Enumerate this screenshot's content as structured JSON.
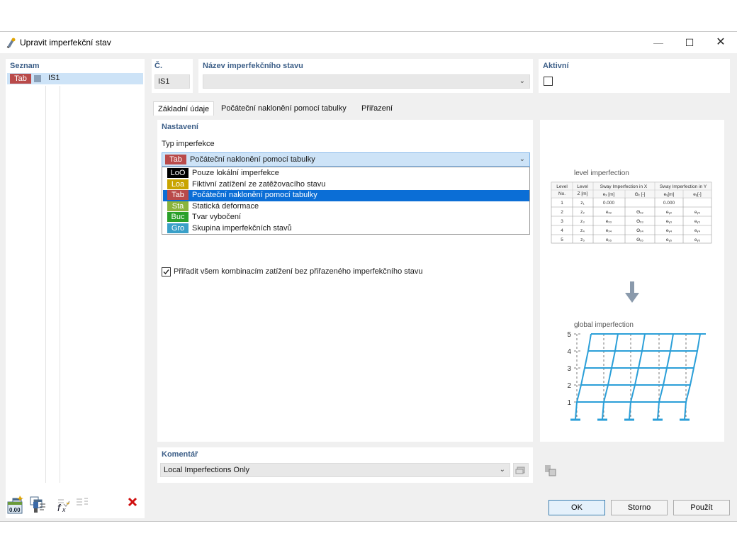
{
  "window": {
    "title": "Upravit imperfekční stav"
  },
  "sidebar": {
    "title": "Seznam",
    "items": [
      {
        "tag": "Tab",
        "tag_color": "#b94a4a",
        "label": "IS1"
      }
    ]
  },
  "header": {
    "number_label": "Č.",
    "number_value": "IS1",
    "name_label": "Název imperfekčního stavu",
    "name_value": "",
    "active_label": "Aktivní"
  },
  "tabs": [
    {
      "label": "Základní údaje",
      "active": true
    },
    {
      "label": "Počáteční naklonění pomocí tabulky",
      "active": false
    },
    {
      "label": "Přiřazení",
      "active": false
    }
  ],
  "settings": {
    "title": "Nastavení",
    "type_label": "Typ imperfekce",
    "selected": {
      "tag": "Tab",
      "color": "#b94a4a",
      "label": "Počáteční naklonění pomocí tabulky"
    },
    "options": [
      {
        "tag": "LoO",
        "color": "#000000",
        "label": "Pouze lokální imperfekce",
        "selected": false
      },
      {
        "tag": "Loa",
        "color": "#c9a400",
        "label": "Fiktivní zatížení ze zatěžovacího stavu",
        "selected": false
      },
      {
        "tag": "Tab",
        "color": "#b94a4a",
        "label": "Počáteční naklonění pomocí tabulky",
        "selected": true
      },
      {
        "tag": "Sta",
        "color": "#8ab43c",
        "label": "Statická deformace",
        "selected": false
      },
      {
        "tag": "Buc",
        "color": "#2aa02a",
        "label": "Tvar vybočení",
        "selected": false
      },
      {
        "tag": "Gro",
        "color": "#3aa0c8",
        "label": "Skupina imperfekčních stavů",
        "selected": false
      }
    ],
    "assign_checkbox_label": "Přiřadit všem kombinacím zatížení bez přiřazeného imperfekčního stavu",
    "assign_checked": true
  },
  "comment": {
    "title": "Komentář",
    "value": "Local Imperfections Only"
  },
  "preview": {
    "table_title": "level imperfection",
    "global_title": "global imperfection",
    "head1": [
      "Level",
      "Level",
      "Sway Imperfection in X",
      "Sway Imperfection in Y"
    ],
    "head1b": [
      "No.",
      "Z [m]"
    ],
    "head2": [
      "eₓ [m]",
      "Θₓ [-]",
      "eᵧ[m]",
      "eᵧ[-]"
    ],
    "rows": [
      [
        "1",
        "z₁",
        "0.000",
        "",
        "0.000",
        ""
      ],
      [
        "2",
        "z₂",
        "eₓ₂",
        "Θₓ₂",
        "eᵧ₂",
        "eᵧ₂"
      ],
      [
        "3",
        "z₃",
        "eₓ₃",
        "Θₓ₃",
        "eᵧ₃",
        "eᵧ₃"
      ],
      [
        "4",
        "z₄",
        "eₓ₄",
        "Θₓ₄",
        "eᵧ₄",
        "eᵧ₄"
      ],
      [
        "5",
        "z₅",
        "eₓ₅",
        "Θₓ₅",
        "eᵧ₅",
        "eᵧ₅"
      ]
    ],
    "levels": [
      "5",
      "4",
      "3",
      "2",
      "1"
    ]
  },
  "footer": {
    "ok": "OK",
    "cancel": "Storno",
    "apply": "Použít"
  },
  "colors": {
    "accent": "#3d5f88",
    "selection": "#0b6ed6",
    "structure": "#2b9fd8"
  }
}
